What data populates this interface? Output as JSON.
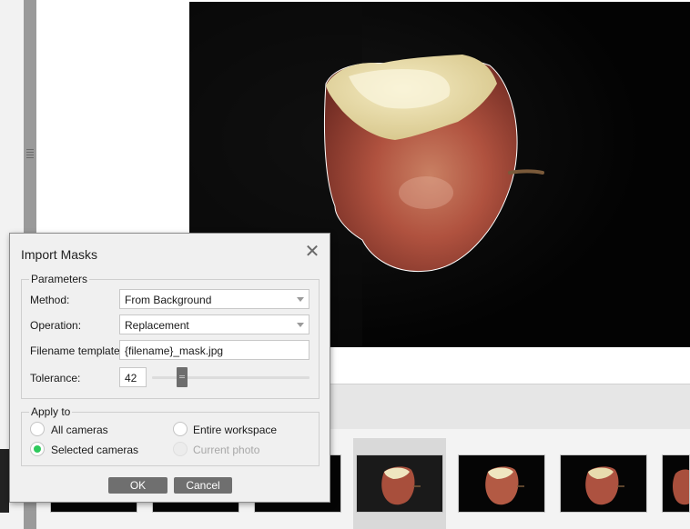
{
  "dialog": {
    "title": "Import Masks",
    "close_icon": "close-icon",
    "parameters": {
      "legend": "Parameters",
      "method_label": "Method:",
      "method_value": "From Background",
      "operation_label": "Operation:",
      "operation_value": "Replacement",
      "filename_label": "Filename template:",
      "filename_value": "{filename}_mask.jpg",
      "tolerance_label": "Tolerance:",
      "tolerance_value": "42"
    },
    "apply_to": {
      "legend": "Apply to",
      "options": [
        {
          "label": "All cameras",
          "checked": false,
          "disabled": false
        },
        {
          "label": "Entire workspace",
          "checked": false,
          "disabled": false
        },
        {
          "label": "Selected cameras",
          "checked": true,
          "disabled": false
        },
        {
          "label": "Current photo",
          "checked": false,
          "disabled": true
        }
      ]
    },
    "ok_label": "OK",
    "cancel_label": "Cancel"
  },
  "colors": {
    "radio_selected": "#2ec95c",
    "button_bg": "#6f6f6f",
    "photo_bg": "#000000"
  }
}
